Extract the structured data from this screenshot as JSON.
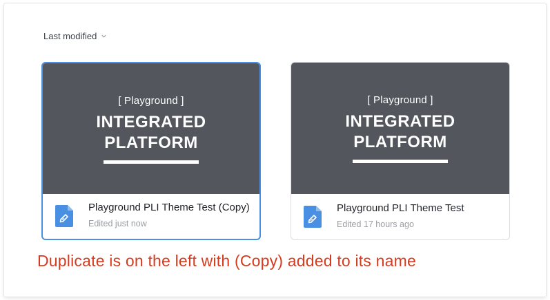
{
  "sort": {
    "label": "Last modified",
    "icon": "chevron-down-icon"
  },
  "files": [
    {
      "thumbnail": {
        "kicker": "[ Playground ]",
        "title_line1": "INTEGRATED",
        "title_line2": "PLATFORM"
      },
      "name": "Playground PLI Theme Test (Copy)",
      "edited": "Edited just now",
      "icon": "document-pen-icon",
      "selected": true
    },
    {
      "thumbnail": {
        "kicker": "[ Playground ]",
        "title_line1": "INTEGRATED",
        "title_line2": "PLATFORM"
      },
      "name": "Playground PLI Theme Test",
      "edited": "Edited 17 hours ago",
      "icon": "document-pen-icon",
      "selected": false
    }
  ],
  "annotation": "Duplicate is on the left with (Copy) added to its name",
  "colors": {
    "thumbnail_bg": "#53565d",
    "selection_border": "#4a90e2",
    "annotation_text": "#d63b1f",
    "doc_icon": "#4a90e2"
  }
}
